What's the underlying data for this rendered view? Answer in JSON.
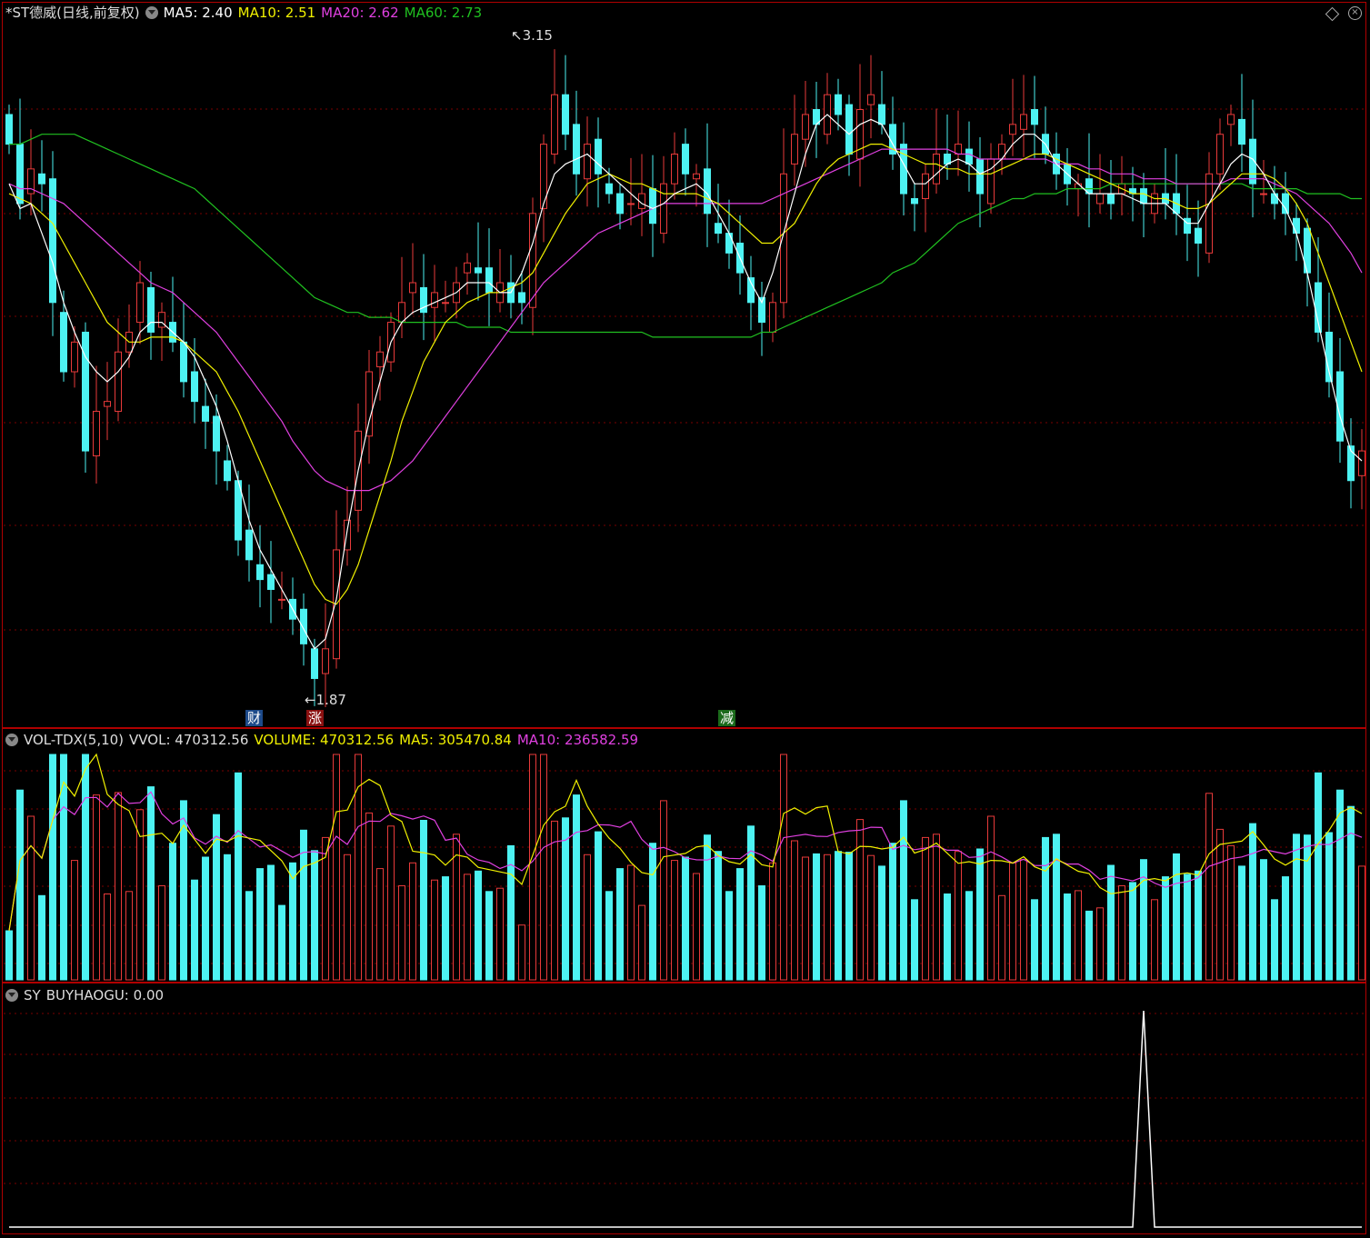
{
  "main": {
    "title": "*ST德威(日线,前复权)",
    "ma5_label": "MA5: 2.40",
    "ma10_label": "MA10: 2.51",
    "ma20_label": "MA20: 2.62",
    "ma60_label": "MA60: 2.73",
    "high_label": "3.15",
    "low_label": "1.87",
    "markers": [
      {
        "text": "财",
        "bg": "#1d4a8a"
      },
      {
        "text": "涨",
        "bg": "#8a1010"
      },
      {
        "text": "减",
        "bg": "#1a6a1a"
      }
    ],
    "close_prices": [
      2.98,
      2.86,
      2.93,
      2.9,
      2.66,
      2.52,
      2.58,
      2.36,
      2.44,
      2.46,
      2.56,
      2.6,
      2.7,
      2.6,
      2.64,
      2.58,
      2.5,
      2.46,
      2.42,
      2.36,
      2.3,
      2.18,
      2.14,
      2.1,
      2.08,
      2.06,
      2.02,
      1.97,
      1.9,
      1.96,
      2.16,
      2.22,
      2.4,
      2.52,
      2.56,
      2.62,
      2.66,
      2.7,
      2.64,
      2.68,
      2.66,
      2.7,
      2.74,
      2.72,
      2.68,
      2.7,
      2.66,
      2.66,
      2.84,
      2.98,
      3.08,
      3.0,
      2.92,
      2.98,
      2.92,
      2.88,
      2.84,
      2.86,
      2.88,
      2.82,
      2.9,
      2.96,
      2.92,
      2.92,
      2.84,
      2.8,
      2.76,
      2.72,
      2.66,
      2.62,
      2.66,
      2.92,
      3.0,
      3.04,
      3.02,
      3.08,
      3.04,
      2.96,
      3.05,
      3.08,
      3.02,
      2.96,
      2.88,
      2.86,
      2.92,
      2.96,
      2.94,
      2.98,
      2.94,
      2.88,
      2.95,
      2.98,
      3.02,
      3.04,
      3.02,
      2.96,
      2.92,
      2.9,
      2.9,
      2.88,
      2.88,
      2.86,
      2.9,
      2.88,
      2.86,
      2.88,
      2.86,
      2.84,
      2.8,
      2.78,
      2.92,
      3.0,
      3.04,
      2.98,
      2.9,
      2.88,
      2.86,
      2.84,
      2.8,
      2.72,
      2.6,
      2.5,
      2.38,
      2.3,
      2.36
    ],
    "ma5": [
      2.9,
      2.85,
      2.86,
      2.8,
      2.74,
      2.66,
      2.6,
      2.55,
      2.52,
      2.5,
      2.52,
      2.55,
      2.6,
      2.62,
      2.62,
      2.6,
      2.58,
      2.55,
      2.5,
      2.45,
      2.38,
      2.3,
      2.22,
      2.16,
      2.12,
      2.08,
      2.04,
      2.0,
      1.96,
      1.98,
      2.06,
      2.2,
      2.32,
      2.42,
      2.5,
      2.58,
      2.62,
      2.64,
      2.65,
      2.66,
      2.67,
      2.68,
      2.7,
      2.7,
      2.7,
      2.68,
      2.68,
      2.72,
      2.78,
      2.86,
      2.92,
      2.94,
      2.95,
      2.96,
      2.94,
      2.92,
      2.9,
      2.88,
      2.86,
      2.85,
      2.86,
      2.88,
      2.89,
      2.9,
      2.88,
      2.84,
      2.8,
      2.75,
      2.7,
      2.66,
      2.72,
      2.8,
      2.88,
      2.96,
      3.02,
      3.04,
      3.02,
      3.0,
      3.02,
      3.03,
      3.02,
      2.98,
      2.94,
      2.9,
      2.9,
      2.92,
      2.94,
      2.95,
      2.94,
      2.92,
      2.93,
      2.95,
      2.98,
      3.0,
      3.0,
      2.98,
      2.94,
      2.92,
      2.9,
      2.88,
      2.88,
      2.88,
      2.88,
      2.87,
      2.86,
      2.86,
      2.86,
      2.84,
      2.82,
      2.82,
      2.86,
      2.9,
      2.94,
      2.96,
      2.95,
      2.92,
      2.88,
      2.85,
      2.8,
      2.72,
      2.62,
      2.52,
      2.43,
      2.36,
      2.34
    ],
    "ma10": [
      2.88,
      2.87,
      2.86,
      2.84,
      2.82,
      2.78,
      2.74,
      2.7,
      2.66,
      2.62,
      2.6,
      2.58,
      2.58,
      2.59,
      2.59,
      2.59,
      2.58,
      2.56,
      2.54,
      2.52,
      2.48,
      2.44,
      2.39,
      2.34,
      2.29,
      2.24,
      2.19,
      2.14,
      2.09,
      2.06,
      2.05,
      2.08,
      2.13,
      2.2,
      2.27,
      2.34,
      2.42,
      2.48,
      2.54,
      2.58,
      2.62,
      2.64,
      2.66,
      2.67,
      2.68,
      2.68,
      2.69,
      2.7,
      2.72,
      2.76,
      2.8,
      2.84,
      2.87,
      2.9,
      2.91,
      2.92,
      2.91,
      2.9,
      2.9,
      2.89,
      2.88,
      2.88,
      2.88,
      2.88,
      2.87,
      2.86,
      2.84,
      2.82,
      2.8,
      2.78,
      2.78,
      2.8,
      2.82,
      2.86,
      2.9,
      2.93,
      2.95,
      2.96,
      2.97,
      2.98,
      2.98,
      2.97,
      2.96,
      2.95,
      2.94,
      2.94,
      2.93,
      2.93,
      2.92,
      2.92,
      2.92,
      2.93,
      2.94,
      2.95,
      2.96,
      2.96,
      2.95,
      2.94,
      2.93,
      2.92,
      2.91,
      2.9,
      2.89,
      2.88,
      2.88,
      2.87,
      2.87,
      2.86,
      2.85,
      2.85,
      2.86,
      2.88,
      2.9,
      2.92,
      2.92,
      2.92,
      2.91,
      2.89,
      2.86,
      2.82,
      2.76,
      2.7,
      2.64,
      2.58,
      2.52
    ],
    "ma20": [
      2.9,
      2.89,
      2.89,
      2.88,
      2.87,
      2.86,
      2.84,
      2.82,
      2.8,
      2.78,
      2.76,
      2.74,
      2.72,
      2.7,
      2.69,
      2.68,
      2.66,
      2.64,
      2.62,
      2.6,
      2.57,
      2.54,
      2.51,
      2.48,
      2.45,
      2.42,
      2.38,
      2.35,
      2.32,
      2.3,
      2.29,
      2.28,
      2.28,
      2.28,
      2.29,
      2.3,
      2.32,
      2.34,
      2.37,
      2.4,
      2.43,
      2.46,
      2.49,
      2.52,
      2.55,
      2.58,
      2.61,
      2.64,
      2.67,
      2.7,
      2.72,
      2.74,
      2.76,
      2.78,
      2.8,
      2.81,
      2.82,
      2.83,
      2.84,
      2.85,
      2.86,
      2.86,
      2.86,
      2.86,
      2.86,
      2.86,
      2.86,
      2.86,
      2.86,
      2.86,
      2.87,
      2.88,
      2.89,
      2.9,
      2.91,
      2.92,
      2.93,
      2.94,
      2.95,
      2.96,
      2.97,
      2.97,
      2.97,
      2.97,
      2.97,
      2.97,
      2.97,
      2.96,
      2.96,
      2.95,
      2.95,
      2.95,
      2.95,
      2.95,
      2.95,
      2.95,
      2.94,
      2.94,
      2.94,
      2.93,
      2.93,
      2.92,
      2.92,
      2.92,
      2.91,
      2.91,
      2.91,
      2.9,
      2.9,
      2.9,
      2.9,
      2.9,
      2.91,
      2.91,
      2.91,
      2.91,
      2.9,
      2.89,
      2.88,
      2.86,
      2.84,
      2.82,
      2.79,
      2.76,
      2.72
    ],
    "ma60": [
      2.98,
      2.98,
      2.99,
      3.0,
      3.0,
      3.0,
      3.0,
      2.99,
      2.98,
      2.97,
      2.96,
      2.95,
      2.94,
      2.93,
      2.92,
      2.91,
      2.9,
      2.89,
      2.87,
      2.85,
      2.83,
      2.81,
      2.79,
      2.77,
      2.75,
      2.73,
      2.71,
      2.69,
      2.67,
      2.66,
      2.65,
      2.64,
      2.64,
      2.63,
      2.63,
      2.63,
      2.62,
      2.62,
      2.62,
      2.62,
      2.62,
      2.62,
      2.61,
      2.61,
      2.61,
      2.61,
      2.6,
      2.6,
      2.6,
      2.6,
      2.6,
      2.6,
      2.6,
      2.6,
      2.6,
      2.6,
      2.6,
      2.6,
      2.6,
      2.59,
      2.59,
      2.59,
      2.59,
      2.59,
      2.59,
      2.59,
      2.59,
      2.59,
      2.59,
      2.6,
      2.6,
      2.61,
      2.62,
      2.63,
      2.64,
      2.65,
      2.66,
      2.67,
      2.68,
      2.69,
      2.7,
      2.72,
      2.73,
      2.74,
      2.76,
      2.78,
      2.8,
      2.82,
      2.83,
      2.84,
      2.85,
      2.86,
      2.87,
      2.87,
      2.88,
      2.88,
      2.88,
      2.89,
      2.89,
      2.89,
      2.89,
      2.9,
      2.9,
      2.9,
      2.9,
      2.9,
      2.9,
      2.9,
      2.9,
      2.9,
      2.9,
      2.9,
      2.9,
      2.9,
      2.89,
      2.89,
      2.89,
      2.89,
      2.89,
      2.88,
      2.88,
      2.88,
      2.88,
      2.87,
      2.87
    ]
  },
  "volume": {
    "indicator": "VOL-TDX(5,10)",
    "vvol_label": "VVOL: 470312.56",
    "volume_label": "VOLUME: 470312.56",
    "ma5_label": "MA5: 305470.84",
    "ma10_label": "MA10: 236582.59"
  },
  "sy": {
    "indicator": "SY",
    "value_label": "BUYHAOGU: 0.00",
    "spike_index": 104
  },
  "colors": {
    "up": "#e83a3a",
    "down": "#4df2f2",
    "ma5": "#ffffff",
    "ma10": "#f0f000",
    "ma20": "#e040e0",
    "ma60": "#20c020",
    "grid": "#7a0000"
  }
}
